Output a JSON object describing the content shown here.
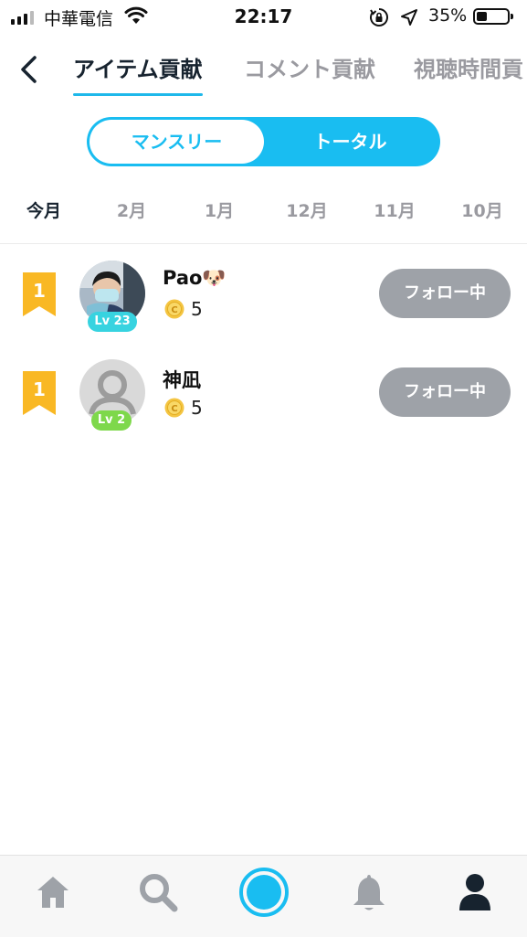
{
  "status_bar": {
    "carrier": "中華電信",
    "time": "22:17",
    "battery_percent": "35%",
    "battery_level": 0.35
  },
  "header": {
    "back_icon": "chevron-left-icon",
    "tabs": [
      {
        "label": "アイテム貢献",
        "active": true
      },
      {
        "label": "コメント貢献",
        "active": false
      },
      {
        "label": "視聴時間貢",
        "active": false
      }
    ]
  },
  "segmented": {
    "monthly_label": "マンスリー",
    "total_label": "トータル",
    "selected": "total"
  },
  "month_tabs": [
    "今月",
    "2月",
    "1月",
    "12月",
    "11月",
    "10月"
  ],
  "ranking": [
    {
      "rank": "1",
      "name": "Pao🐶",
      "level": "Lv 23",
      "level_color": "#37d3e0",
      "coins": "5",
      "follow_label": "フォロー中",
      "avatar": "user-photo"
    },
    {
      "rank": "1",
      "name": "神凪",
      "level": "Lv 2",
      "level_color": "#7ed84b",
      "coins": "5",
      "follow_label": "フォロー中",
      "avatar": "default-avatar"
    }
  ],
  "bottom_nav": [
    {
      "icon": "home-icon",
      "active": false
    },
    {
      "icon": "search-icon",
      "active": false
    },
    {
      "icon": "live-broadcast-icon",
      "active": false
    },
    {
      "icon": "bell-icon",
      "active": false
    },
    {
      "icon": "profile-icon",
      "active": true
    }
  ],
  "colors": {
    "accent": "#19bdf1",
    "rank_badge": "#f9b824",
    "follow_button": "#9ea2a8",
    "coin": "#f4c542"
  }
}
